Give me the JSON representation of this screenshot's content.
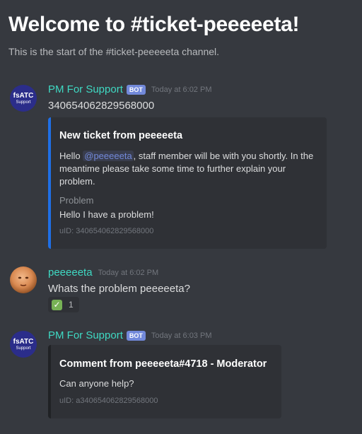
{
  "welcome": {
    "title": "Welcome to #ticket-peeeeeta!",
    "subtitle": "This is the start of the #ticket-peeeeeta channel."
  },
  "messages": [
    {
      "author": "PM For Support",
      "bot_tag": "BOT",
      "timestamp": "Today at 6:02 PM",
      "avatar": {
        "line1": "fsATC",
        "line2": "Support"
      },
      "content": "340654062829568000",
      "embed": {
        "title": "New ticket from peeeeeta",
        "desc_prefix": "Hello ",
        "mention": "@peeeeeta",
        "desc_suffix": ", staff member will be with you shortly. In the meantime please take some time to further explain your problem.",
        "field_name": "Problem",
        "field_value": "Hello I have a problem!",
        "footer": "uID: 340654062829568000",
        "accent_color": "#1f6fe6"
      }
    },
    {
      "author": "peeeeeta",
      "timestamp": "Today at 6:02 PM",
      "content": "Whats the problem peeeeeta?",
      "reaction": {
        "emoji": "✓",
        "count": "1"
      }
    },
    {
      "author": "PM For Support",
      "bot_tag": "BOT",
      "timestamp": "Today at 6:03 PM",
      "avatar": {
        "line1": "fsATC",
        "line2": "Support"
      },
      "embed": {
        "title": "Comment from peeeeeta#4718 - Moderator",
        "description": "Can anyone help?",
        "footer": "uID: a340654062829568000"
      }
    }
  ]
}
